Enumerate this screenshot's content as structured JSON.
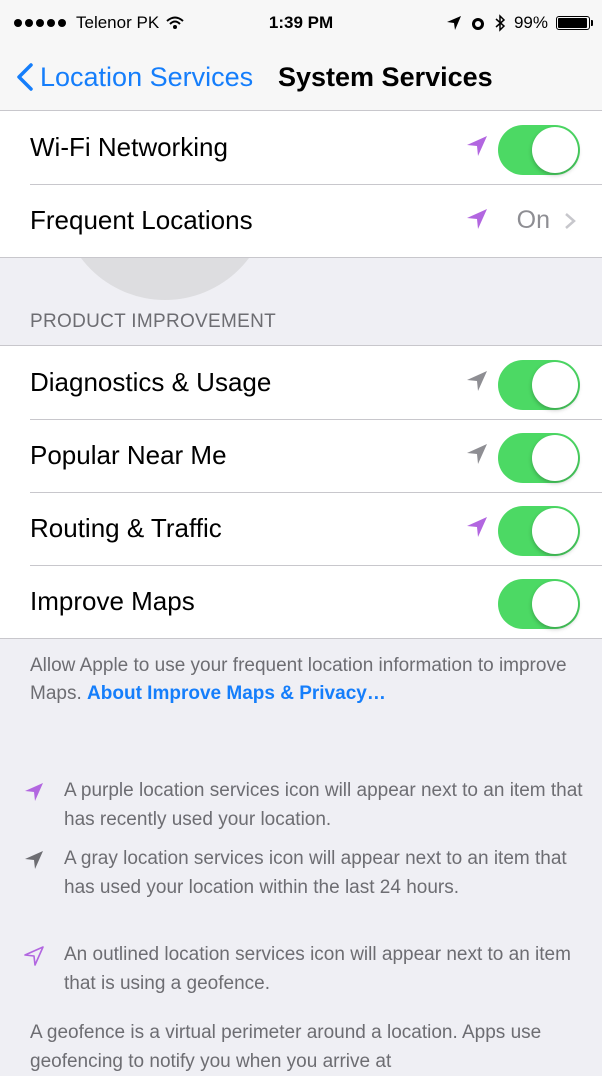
{
  "status_bar": {
    "carrier": "Telenor PK",
    "time": "1:39 PM",
    "battery": "99%"
  },
  "nav": {
    "back_label": "Location Services",
    "title": "System Services"
  },
  "group1": {
    "rows": [
      {
        "label": "Wi-Fi Networking",
        "icon": "location-arrow-purple",
        "toggle": true
      },
      {
        "label": "Frequent Locations",
        "icon": "location-arrow-purple",
        "value": "On"
      }
    ]
  },
  "section": {
    "header": "PRODUCT IMPROVEMENT",
    "rows": [
      {
        "label": "Diagnostics & Usage",
        "icon": "location-arrow-gray",
        "toggle": true
      },
      {
        "label": "Popular Near Me",
        "icon": "location-arrow-gray",
        "toggle": true
      },
      {
        "label": "Routing & Traffic",
        "icon": "location-arrow-purple",
        "toggle": true
      },
      {
        "label": "Improve Maps",
        "toggle": true
      }
    ],
    "footer_text": "Allow Apple to use your frequent location information to improve Maps.",
    "footer_link": "About Improve Maps & Privacy…"
  },
  "legend": [
    {
      "icon": "location-arrow-purple",
      "text": "A purple location services icon will appear next to an item that has recently used your location."
    },
    {
      "icon": "location-arrow-gray",
      "text": "A gray location services icon will appear next to an item that has used your location within the last 24 hours."
    },
    {
      "icon": "location-arrow-outline",
      "text": "An outlined location services icon will appear next to an item that is using a geofence."
    }
  ],
  "geofence_text": "A geofence is a virtual perimeter around a location. Apps use geofencing to notify you when you arrive at",
  "colors": {
    "accent": "#157efb",
    "toggle_on": "#4cd964",
    "purple": "#b266e0",
    "gray_icon": "#8e8e93",
    "background": "#efeff4"
  }
}
